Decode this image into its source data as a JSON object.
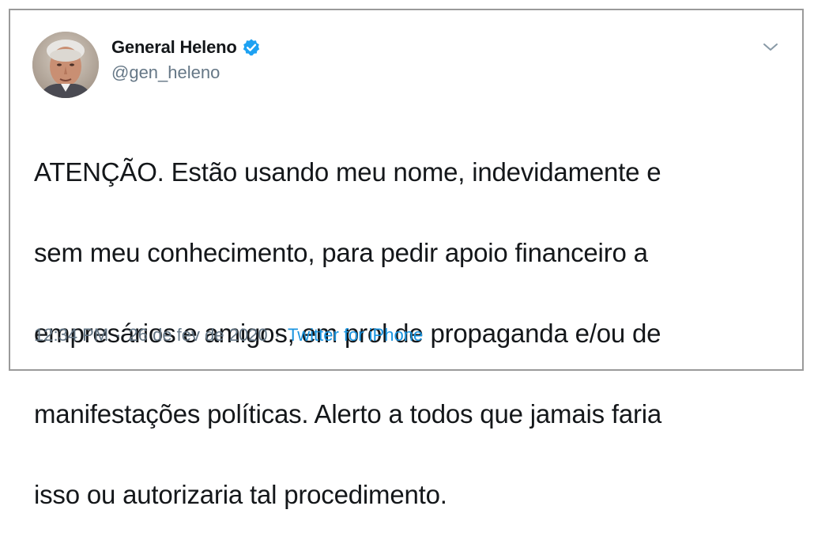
{
  "tweet": {
    "author": {
      "display_name": "General Heleno",
      "handle": "@gen_heleno",
      "verified": true,
      "avatar_icon": "profile-photo"
    },
    "menu_icon": "chevron-down-icon",
    "lines": [
      "ATENÇÃO. Estão usando meu nome, indevidamente e",
      "sem meu conhecimento, para pedir apoio financeiro a",
      "empresários e amigos, em prol de propaganda e/ou de",
      "manifestações políticas.  Alerto a todos que jamais faria",
      "isso ou autorizaria tal procedimento."
    ],
    "meta": {
      "time": "12:34 PM",
      "separator": "·",
      "date": "26 de fev de 2020",
      "source": "Twitter for iPhone"
    }
  },
  "colors": {
    "text_primary": "#14171a",
    "text_secondary": "#657786",
    "link": "#1b95e0",
    "verified_badge": "#1da1f2",
    "border": "#9a9a9a"
  }
}
